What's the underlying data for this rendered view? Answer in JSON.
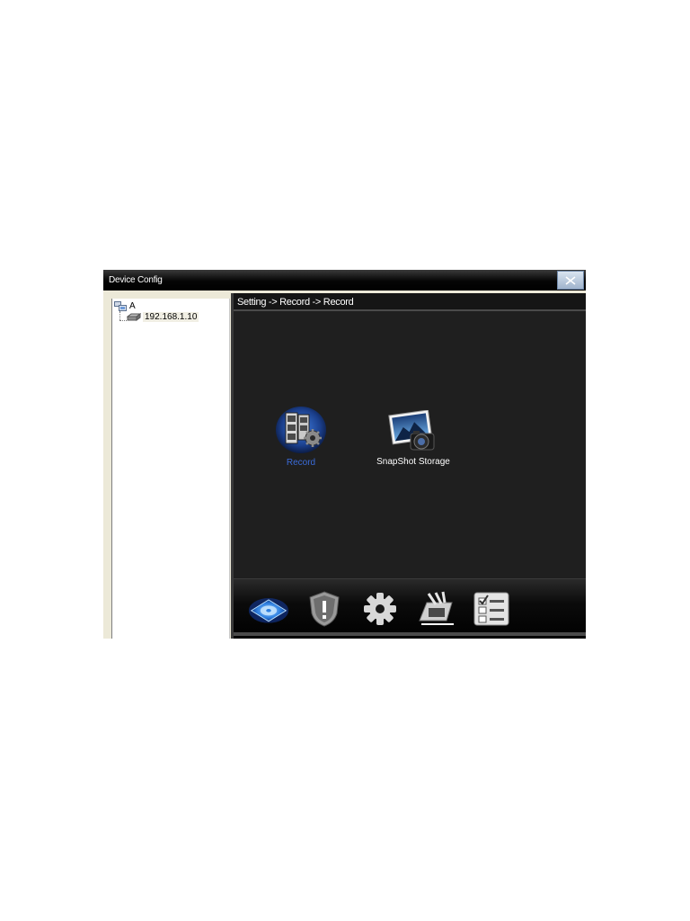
{
  "window": {
    "title": "Device Config"
  },
  "tree": {
    "root_label": "A",
    "child_label": "192.168.1.10"
  },
  "breadcrumb": "Setting -> Record -> Record",
  "content": {
    "items": [
      {
        "label": "Record",
        "icon": "record-film-gear-icon"
      },
      {
        "label": "SnapShot Storage",
        "icon": "camera-photo-icon"
      }
    ]
  },
  "bottom_nav": {
    "items": [
      {
        "icon": "storage-disk-icon",
        "active": true
      },
      {
        "icon": "alarm-shield-icon",
        "active": false
      },
      {
        "icon": "gear-icon",
        "active": false
      },
      {
        "icon": "tools-icon",
        "active": false
      },
      {
        "icon": "checklist-icon",
        "active": false
      }
    ]
  },
  "colors": {
    "content_bg": "#1f1f1f",
    "active_label": "#3a6bd8",
    "title_bar": "#000000"
  }
}
